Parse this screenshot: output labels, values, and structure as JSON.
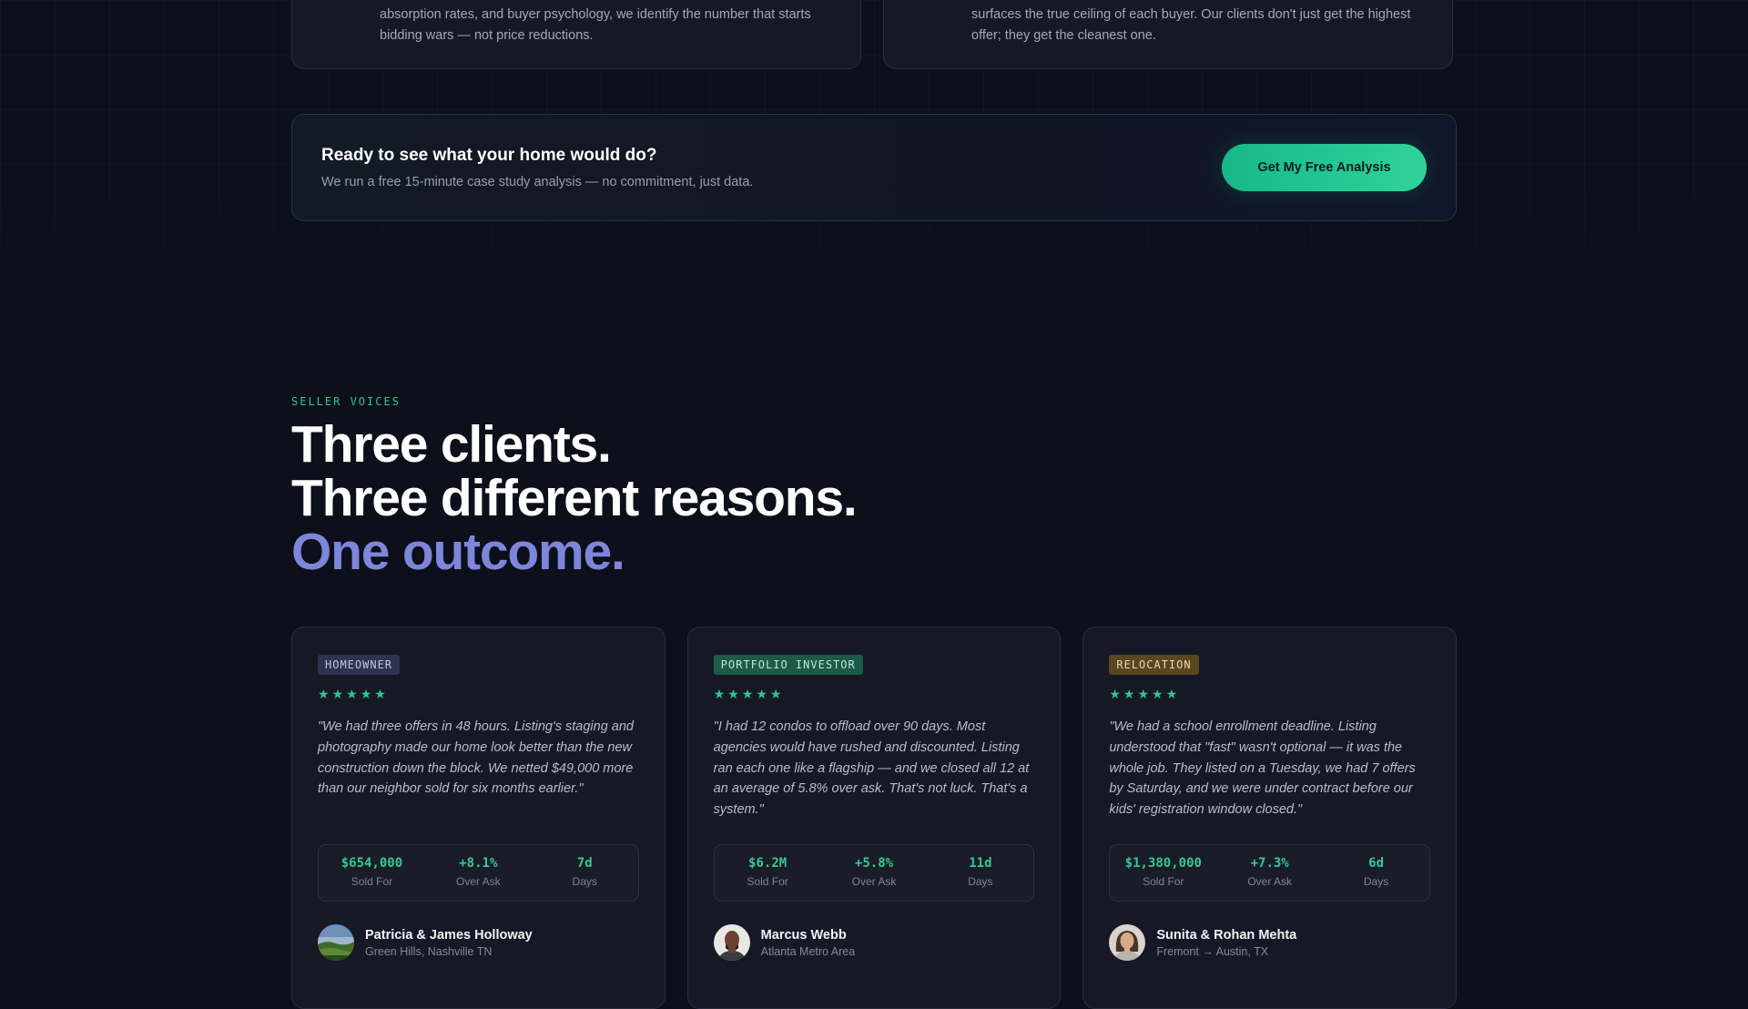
{
  "top_cards": [
    {
      "text": "absorption rates, and buyer psychology, we identify the number that starts bidding wars — not price reductions."
    },
    {
      "text": "surfaces the true ceiling of each buyer. Our clients don't just get the highest offer; they get the cleanest one."
    }
  ],
  "cta": {
    "title": "Ready to see what your home would do?",
    "subtitle": "We run a free 15-minute case study analysis — no commitment, just data.",
    "button_label": "Get My Free Analysis"
  },
  "section": {
    "eyebrow": "SELLER VOICES",
    "headline_line1": "Three clients.",
    "headline_line2": "Three different reasons.",
    "headline_line3": "One outcome."
  },
  "colors": {
    "accent_green": "#31c48d",
    "accent_purple": "#7d86d9",
    "background": "#0d0f1a"
  },
  "testimonials": [
    {
      "badge": "HOMEOWNER",
      "rating": 5,
      "quote": "\"We had three offers in 48 hours. Listing's staging and photography made our home look better than the new construction down the block. We netted $49,000 more than our neighbor sold for six months earlier.\"",
      "stats": [
        {
          "value": "$654,000",
          "label": "Sold For"
        },
        {
          "value": "+8.1%",
          "label": "Over Ask"
        },
        {
          "value": "7d",
          "label": "Days"
        }
      ],
      "name": "Patricia & James Holloway",
      "location": "Green Hills, Nashville TN",
      "avatar_icon": "landscape-avatar"
    },
    {
      "badge": "PORTFOLIO INVESTOR",
      "rating": 5,
      "quote": "\"I had 12 condos to offload over 90 days. Most agencies would have rushed and discounted. Listing ran each one like a flagship — and we closed all 12 at an average of 5.8% over ask. That's not luck. That's a system.\"",
      "stats": [
        {
          "value": "$6.2M",
          "label": "Sold For"
        },
        {
          "value": "+5.8%",
          "label": "Over Ask"
        },
        {
          "value": "11d",
          "label": "Days"
        }
      ],
      "name": "Marcus Webb",
      "location": "Atlanta Metro Area",
      "avatar_icon": "man-portrait-avatar"
    },
    {
      "badge": "RELOCATION",
      "rating": 5,
      "quote": "\"We had a school enrollment deadline. Listing understood that \"fast\" wasn't optional — it was the whole job. They listed on a Tuesday, we had 7 offers by Saturday, and we were under contract before our kids' registration window closed.\"",
      "stats": [
        {
          "value": "$1,380,000",
          "label": "Sold For"
        },
        {
          "value": "+7.3%",
          "label": "Over Ask"
        },
        {
          "value": "6d",
          "label": "Days"
        }
      ],
      "name": "Sunita & Rohan Mehta",
      "location": "Fremont → Austin, TX",
      "avatar_icon": "woman-portrait-avatar"
    }
  ]
}
